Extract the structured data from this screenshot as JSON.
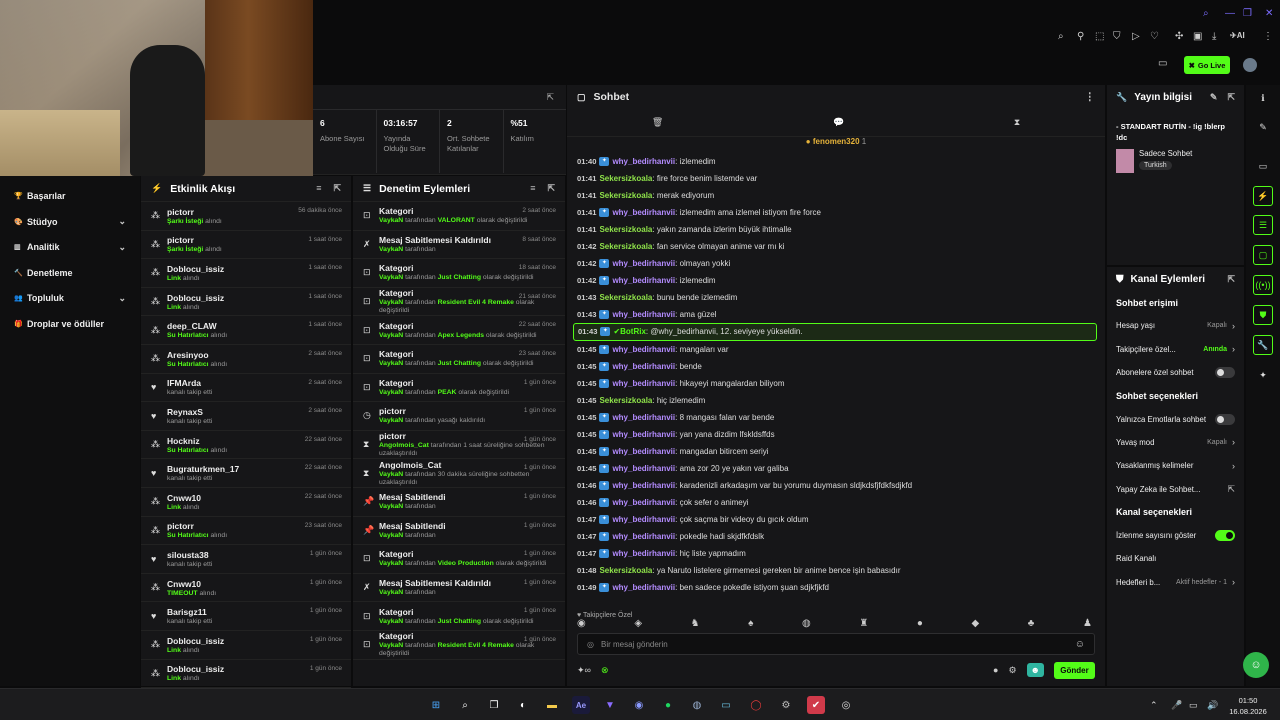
{
  "stats": {
    "items": [
      {
        "value": "6",
        "label": "Abone Sayısı"
      },
      {
        "value": "03:16:57",
        "label": "Yayında Olduğu Süre"
      },
      {
        "value": "2",
        "label": "Ort. Sohbete Katılanlar"
      },
      {
        "value": "%51",
        "label": "Katılım"
      }
    ]
  },
  "topbar": {
    "go_live": "Go Live",
    "ai": "AI"
  },
  "sidebar": {
    "items": [
      {
        "label": "Başarılar",
        "icon": "trophy-icon",
        "chevron": false
      },
      {
        "label": "Stüdyo",
        "icon": "palette-icon",
        "chevron": true
      },
      {
        "label": "Analitik",
        "icon": "chart-icon",
        "chevron": true
      },
      {
        "label": "Denetleme",
        "icon": "hammer-icon",
        "chevron": false
      },
      {
        "label": "Topluluk",
        "icon": "people-icon",
        "chevron": true
      },
      {
        "label": "Droplar ve ödüller",
        "icon": "gift-icon",
        "chevron": false
      }
    ]
  },
  "activity": {
    "title": "Etkinlik Akışı",
    "items": [
      {
        "name": "pictorr",
        "sub_hl": "Şarkı İsteği",
        "sub": " alındı",
        "time": "56 dakika önce",
        "icon": "chanpoint"
      },
      {
        "name": "pictorr",
        "sub_hl": "Şarkı İsteği",
        "sub": " alındı",
        "time": "1 saat önce",
        "icon": "chanpoint"
      },
      {
        "name": "Doblocu_issiz",
        "sub_hl": "Link",
        "sub": " alındı",
        "time": "1 saat önce",
        "icon": "chanpoint"
      },
      {
        "name": "Doblocu_issiz",
        "sub_hl": "Link",
        "sub": " alındı",
        "time": "1 saat önce",
        "icon": "chanpoint"
      },
      {
        "name": "deep_CLAW",
        "sub_hl": "Su Hatırlatıcı",
        "sub": " alındı",
        "time": "1 saat önce",
        "icon": "chanpoint"
      },
      {
        "name": "Aresinyoo",
        "sub_hl": "Su Hatırlatıcı",
        "sub": " alındı",
        "time": "2 saat önce",
        "icon": "chanpoint"
      },
      {
        "name": "IFMArda",
        "sub_hl": "",
        "sub": "kanalı takip etti",
        "time": "2 saat önce",
        "icon": "heart"
      },
      {
        "name": "ReynaxS",
        "sub_hl": "",
        "sub": "kanalı takip etti",
        "time": "2 saat önce",
        "icon": "heart"
      },
      {
        "name": "Hockniz",
        "sub_hl": "Su Hatırlatıcı",
        "sub": " alındı",
        "time": "22 saat önce",
        "icon": "chanpoint"
      },
      {
        "name": "Bugraturkmen_17",
        "sub_hl": "",
        "sub": "kanalı takip etti",
        "time": "22 saat önce",
        "icon": "heart"
      },
      {
        "name": "Cnww10",
        "sub_hl": "Link",
        "sub": " alındı",
        "time": "22 saat önce",
        "icon": "chanpoint"
      },
      {
        "name": "pictorr",
        "sub_hl": "Su Hatırlatıcı",
        "sub": " alındı",
        "time": "23 saat önce",
        "icon": "chanpoint"
      },
      {
        "name": "silousta38",
        "sub_hl": "",
        "sub": "kanalı takip etti",
        "time": "1 gün önce",
        "icon": "heart"
      },
      {
        "name": "Cnww10",
        "sub_hl": "TIMEOUT",
        "sub": " alındı",
        "time": "1 gün önce",
        "icon": "chanpoint"
      },
      {
        "name": "Barisgz11",
        "sub_hl": "",
        "sub": "kanalı takip etti",
        "time": "1 gün önce",
        "icon": "heart"
      },
      {
        "name": "Doblocu_issiz",
        "sub_hl": "Link",
        "sub": " alındı",
        "time": "1 gün önce",
        "icon": "chanpoint"
      },
      {
        "name": "Doblocu_issiz",
        "sub_hl": "Link",
        "sub": " alındı",
        "time": "1 gün önce",
        "icon": "chanpoint"
      }
    ]
  },
  "moderation": {
    "title": "Denetim Eylemleri",
    "items": [
      {
        "name": "Kategori",
        "actor": "VaykaN",
        "pre": " tarafından ",
        "hl": "VALORANT",
        "post": " olarak değiştirildi",
        "time": "2 saat önce",
        "icon": "category"
      },
      {
        "name": "Mesaj Sabitlemesi Kaldırıldı",
        "actor": "VaykaN",
        "pre": " tarafından",
        "hl": "",
        "post": "",
        "time": "8 saat önce",
        "icon": "unpin"
      },
      {
        "name": "Kategori",
        "actor": "VaykaN",
        "pre": " tarafından ",
        "hl": "Just Chatting",
        "post": " olarak değiştirildi",
        "time": "18 saat önce",
        "icon": "category"
      },
      {
        "name": "Kategori",
        "actor": "VaykaN",
        "pre": " tarafından ",
        "hl": "Resident Evil 4 Remake",
        "post": " olarak değiştirildi",
        "time": "21 saat önce",
        "icon": "category"
      },
      {
        "name": "Kategori",
        "actor": "VaykaN",
        "pre": " tarafından ",
        "hl": "Apex Legends",
        "post": " olarak değiştirildi",
        "time": "22 saat önce",
        "icon": "category"
      },
      {
        "name": "Kategori",
        "actor": "VaykaN",
        "pre": " tarafından ",
        "hl": "Just Chatting",
        "post": " olarak değiştirildi",
        "time": "23 saat önce",
        "icon": "category"
      },
      {
        "name": "Kategori",
        "actor": "VaykaN",
        "pre": " tarafından ",
        "hl": "PEAK",
        "post": " olarak değiştirildi",
        "time": "1 gün önce",
        "icon": "category"
      },
      {
        "name": "pictorr",
        "actor": "VaykaN",
        "pre": " tarafından yasağı kaldırıldı",
        "hl": "",
        "post": "",
        "time": "1 gün önce",
        "icon": "clock"
      },
      {
        "name": "pictorr",
        "actor": "Angolmois_Cat",
        "pre": " tarafından 1 saat süreliğine sohbetten uzaklaştırıldı",
        "hl": "",
        "post": "",
        "time": "1 gün önce",
        "icon": "hourglass"
      },
      {
        "name": "Angolmois_Cat",
        "actor": "VaykaN",
        "pre": " tarafından 30 dakika süreliğine sohbetten uzaklaştırıldı",
        "hl": "",
        "post": "",
        "time": "1 gün önce",
        "icon": "hourglass"
      },
      {
        "name": "Mesaj Sabitlendi",
        "actor": "VaykaN",
        "pre": " tarafından",
        "hl": "",
        "post": "",
        "time": "1 gün önce",
        "icon": "pin"
      },
      {
        "name": "Mesaj Sabitlendi",
        "actor": "VaykaN",
        "pre": " tarafından",
        "hl": "",
        "post": "",
        "time": "1 gün önce",
        "icon": "pin"
      },
      {
        "name": "Kategori",
        "actor": "VaykaN",
        "pre": " tarafından ",
        "hl": "Video Production",
        "post": " olarak değiştirildi",
        "time": "1 gün önce",
        "icon": "category"
      },
      {
        "name": "Mesaj Sabitlemesi Kaldırıldı",
        "actor": "VaykaN",
        "pre": " tarafından",
        "hl": "",
        "post": "",
        "time": "1 gün önce",
        "icon": "unpin"
      },
      {
        "name": "Kategori",
        "actor": "VaykaN",
        "pre": " tarafından ",
        "hl": "Just Chatting",
        "post": " olarak değiştirildi",
        "time": "1 gün önce",
        "icon": "category"
      },
      {
        "name": "Kategori",
        "actor": "VaykaN",
        "pre": " tarafından ",
        "hl": "Resident Evil 4 Remake",
        "post": " olarak değiştirildi",
        "time": "1 gün önce",
        "icon": "category"
      }
    ]
  },
  "chat": {
    "title": "Sohbet",
    "pinned_user": "fenomen320",
    "pinned_count": "1",
    "messages": [
      {
        "t": "01:40",
        "u": "why_bedirhanvii",
        "c": "p",
        "badge": true,
        "m": ": izlemedim"
      },
      {
        "t": "01:41",
        "u": "Sekersizkoala",
        "c": "y",
        "badge": false,
        "m": ": fire force benim listemde var"
      },
      {
        "t": "01:41",
        "u": "Sekersizkoala",
        "c": "y",
        "badge": false,
        "m": ": merak ediyorum"
      },
      {
        "t": "01:41",
        "u": "why_bedirhanvii",
        "c": "p",
        "badge": true,
        "m": ": izlemedim ama izlemel istiyom fire force"
      },
      {
        "t": "01:41",
        "u": "Sekersizkoala",
        "c": "y",
        "badge": false,
        "m": ": yakın zamanda izlerim büyük ihtimalle"
      },
      {
        "t": "01:42",
        "u": "Sekersizkoala",
        "c": "y",
        "badge": false,
        "m": ": fan service olmayan anime var mı ki"
      },
      {
        "t": "01:42",
        "u": "why_bedirhanvii",
        "c": "p",
        "badge": true,
        "m": ": olmayan yokki"
      },
      {
        "t": "01:42",
        "u": "why_bedirhanvii",
        "c": "p",
        "badge": true,
        "m": ": izlemedim"
      },
      {
        "t": "01:43",
        "u": "Sekersizkoala",
        "c": "y",
        "badge": false,
        "m": ": bunu bende izlemedim"
      },
      {
        "t": "01:43",
        "u": "why_bedirhanvii",
        "c": "p",
        "badge": true,
        "m": ": ama güzel"
      },
      {
        "t": "01:43",
        "u": "BotRix",
        "c": "b",
        "badge": true,
        "m": ": @why_bedirhanvii, 12. seviyeye yükseldin.",
        "hl": true
      },
      {
        "t": "01:45",
        "u": "why_bedirhanvii",
        "c": "p",
        "badge": true,
        "m": ": mangaları var"
      },
      {
        "t": "01:45",
        "u": "why_bedirhanvii",
        "c": "p",
        "badge": true,
        "m": ": bende"
      },
      {
        "t": "01:45",
        "u": "why_bedirhanvii",
        "c": "p",
        "badge": true,
        "m": ": hikayeyi mangalardan biliyom"
      },
      {
        "t": "01:45",
        "u": "Sekersizkoala",
        "c": "y",
        "badge": false,
        "m": ": hiç izlemedim"
      },
      {
        "t": "01:45",
        "u": "why_bedirhanvii",
        "c": "p",
        "badge": true,
        "m": ": 8 mangası falan var bende"
      },
      {
        "t": "01:45",
        "u": "why_bedirhanvii",
        "c": "p",
        "badge": true,
        "m": ": yan yana dizdim lfskldsffds"
      },
      {
        "t": "01:45",
        "u": "why_bedirhanvii",
        "c": "p",
        "badge": true,
        "m": ": mangadan bitircem seriyi"
      },
      {
        "t": "01:45",
        "u": "why_bedirhanvii",
        "c": "p",
        "badge": true,
        "m": ": ama zor 20 ye yakın var galiba"
      },
      {
        "t": "01:46",
        "u": "why_bedirhanvii",
        "c": "p",
        "badge": true,
        "m": ": karadenizli arkadaşım var bu yorumu duymasın sldjkdsfjfdkfsdjkfd"
      },
      {
        "t": "01:46",
        "u": "why_bedirhanvii",
        "c": "p",
        "badge": true,
        "m": ": çok sefer o animeyi"
      },
      {
        "t": "01:47",
        "u": "why_bedirhanvii",
        "c": "p",
        "badge": true,
        "m": ": çok saçma bir videoy du gıcık oldum"
      },
      {
        "t": "01:47",
        "u": "why_bedirhanvii",
        "c": "p",
        "badge": true,
        "m": ": pokedle hadi skjdfkfdslk"
      },
      {
        "t": "01:47",
        "u": "why_bedirhanvii",
        "c": "p",
        "badge": true,
        "m": ": hiç liste yapmadım"
      },
      {
        "t": "01:48",
        "u": "Sekersizkoala",
        "c": "y",
        "badge": false,
        "m": ": ya Naruto listelere girmemesi gereken bir anime bence işin babasıdır"
      },
      {
        "t": "01:49",
        "u": "why_bedirhanvii",
        "c": "p",
        "badge": true,
        "m": ": ben sadece pokedle istiyom şuan sdjkfjkfd"
      }
    ],
    "emote_label": "Takipçilere Özel",
    "input_placeholder": "Bir mesaj gönderin",
    "send": "Gönder"
  },
  "info": {
    "title": "Yayın bilgisi",
    "stream_title": "- STANDART RUTİN - !ig !blerp !dc",
    "mode": "Sadece Sohbet",
    "language": "Turkish"
  },
  "channel_actions": {
    "title": "Kanal Eylemleri",
    "sections": [
      {
        "heading": "Sohbet erişimi",
        "rows": [
          {
            "label": "Hesap yaşı",
            "value": "Kapalı",
            "type": "chev"
          },
          {
            "label": "Takipçilere özel...",
            "value": "Anında",
            "type": "chev",
            "green": true
          },
          {
            "label": "Abonelere özel sohbet",
            "value": "",
            "type": "toggle",
            "on": false
          }
        ]
      },
      {
        "heading": "Sohbet seçenekleri",
        "rows": [
          {
            "label": "Yalnızca Emotlarla sohbet",
            "value": "",
            "type": "toggle",
            "on": false
          },
          {
            "label": "Yavaş mod",
            "value": "Kapalı",
            "type": "chev"
          },
          {
            "label": "Yasaklanmış kelimeler",
            "value": "",
            "type": "chev"
          },
          {
            "label": "Yapay Zeka ile Sohbet...",
            "value": "",
            "type": "ext"
          }
        ]
      },
      {
        "heading": "Kanal seçenekleri",
        "rows": [
          {
            "label": "İzlenme sayısını göster",
            "value": "",
            "type": "toggle",
            "on": true
          },
          {
            "label": "Raid Kanalı",
            "value": "",
            "type": "none"
          },
          {
            "label": "Hedefleri b...",
            "value": "Aktif hedefler - 1",
            "type": "chev"
          }
        ]
      }
    ]
  },
  "clock": {
    "time": "01:50",
    "date": "16.08.2026"
  }
}
